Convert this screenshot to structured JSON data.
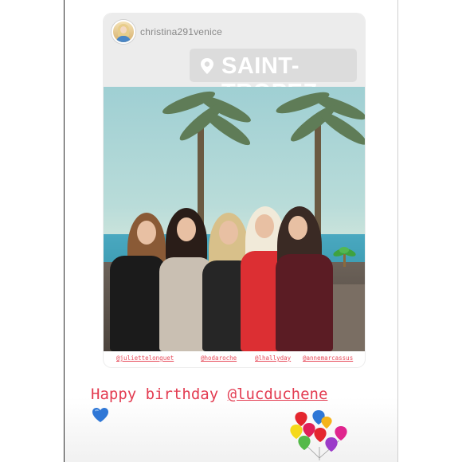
{
  "story": {
    "username": "christina291venice",
    "location_sticker": "SAINT-TROPEZ",
    "tags": [
      "@juliettelonguet",
      "@hodaroche",
      "@lhallyday",
      "@annemarcassus"
    ],
    "caption_text": "Happy birthday ",
    "caption_mention": "@lucduchene",
    "icons": {
      "avatar": "avatar",
      "location": "pin-icon",
      "heart": "blue-heart-icon",
      "balloons": "balloons-icon",
      "palm": "palm-tree-icon"
    },
    "colors": {
      "caption": "#e33d52",
      "tags": "#e74b5a",
      "heart": "#2f77d6"
    }
  }
}
